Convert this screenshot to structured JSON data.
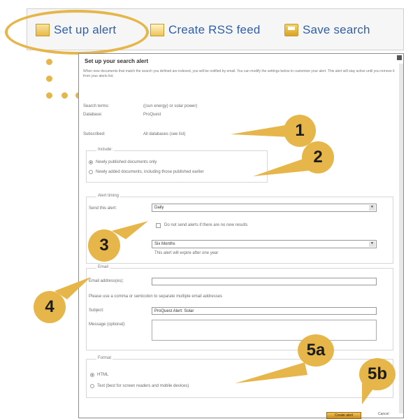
{
  "toolbar": {
    "alert_label": "Set up alert",
    "rss_label": "Create RSS feed",
    "save_label": "Save search"
  },
  "dialog": {
    "title": "Set up your search alert",
    "intro": "When new documents that match the search you defined are indexed, you will be notified by email. You can modify the settings below to customize your alert. This alert will stay active until you remove it from your alerts list.",
    "fields": {
      "search_label": "Search terms:",
      "search_value": "((sun energy) or solar power)",
      "database_label": "Database:",
      "database_value": "ProQuest",
      "subscribed_label": "Subscribed:",
      "subscribed_value": "All databases (see list)"
    },
    "include": {
      "legend": "Include:",
      "option1": "Newly published documents only",
      "option2": "Newly added documents, including those published earlier"
    },
    "schedule": {
      "legend": "Alert timing",
      "frequency_label": "Send this alert:",
      "frequency_value": "Daily",
      "nohits_label": "Do not send alerts if there are no new results",
      "end_value": "Six Months",
      "end_note": "This alert will expire after one year"
    },
    "email": {
      "legend": "Email",
      "to_label": "Email address(es):",
      "to_placeholder": "",
      "note": "Please use a comma or semicolon to separate multiple email addresses",
      "subject_label": "Subject:",
      "subject_value": "ProQuest Alert: Solar",
      "message_label": "Message (optional):"
    },
    "format": {
      "legend": "Format",
      "option1": "HTML",
      "option2": "Text (best for screen readers and mobile devices)"
    },
    "actions": {
      "create_label": "Create alert",
      "cancel_label": "Cancel"
    }
  },
  "callouts": {
    "one": "1",
    "two": "2",
    "three": "3",
    "four": "4",
    "five_a": "5a",
    "five_b": "5b"
  },
  "colors": {
    "accent": "#e6b64a",
    "link": "#2f5fa8"
  }
}
